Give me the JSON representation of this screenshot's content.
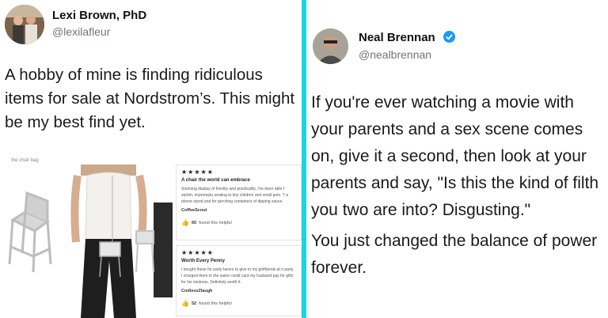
{
  "left_tweet": {
    "display_name": "Lexi Brown, PhD",
    "handle": "@lexilafleur",
    "text": "A hobby of mine is finding ridiculous items for sale at Nordstrom’s. This might be my best find yet.",
    "image": {
      "caption": "the chair bag",
      "reviews": [
        {
          "stars": "★★★★★",
          "title": "A chair the world can embrace",
          "body": "Stunning display of frivolity and practicality. I've been able t stylish, impromptu seating to tiny children and small pets. T a phone stand and for perching containers of dipping sauce.",
          "reviewer": "CoffeeScout",
          "helpful_count": "65",
          "helpful_text": "found this helpful"
        },
        {
          "stars": "★★★★★",
          "title": "Worth Every Penny",
          "body": "I bought these for party favors to give to my girlfriends at n party. I charged them to the same credit card my husband pay for gifts for his mistress. Definitely worth it.",
          "reviewer": "CndlsvsZlaugh",
          "helpful_count": "52",
          "helpful_text": "found this helpful"
        }
      ]
    }
  },
  "right_tweet": {
    "display_name": "Neal Brennan",
    "handle": "@nealbrennan",
    "paragraph_1": "If you're ever watching a movie with your parents and a sex scene comes on, give it a second, then look at your parents and say, \"Is this the kind of filth you two are into? Disgusting.\"",
    "paragraph_2": "You just changed the balance of power forever."
  },
  "icons": {
    "verified": "verified-badge-icon",
    "helpful": "thumbs-up-icon"
  },
  "colors": {
    "divider": "#18d6dc",
    "verified": "#1d9bf0",
    "handle": "#6d767e"
  }
}
